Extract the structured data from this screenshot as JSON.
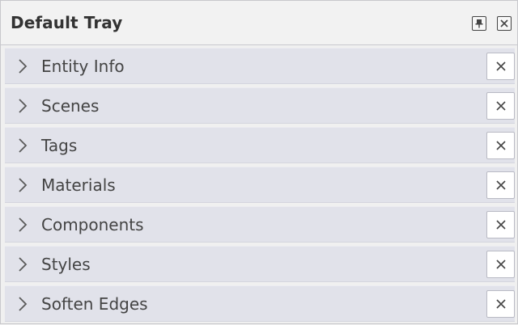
{
  "tray": {
    "title": "Default Tray",
    "header_icons": {
      "pin": "pin-icon",
      "close": "close-icon"
    }
  },
  "panels": [
    {
      "label": "Entity Info",
      "icon": "chevron-right-icon",
      "close_icon": "close-icon"
    },
    {
      "label": "Scenes",
      "icon": "chevron-right-icon",
      "close_icon": "close-icon"
    },
    {
      "label": "Tags",
      "icon": "chevron-right-icon",
      "close_icon": "close-icon"
    },
    {
      "label": "Materials",
      "icon": "chevron-right-icon",
      "close_icon": "close-icon"
    },
    {
      "label": "Components",
      "icon": "chevron-right-icon",
      "close_icon": "close-icon"
    },
    {
      "label": "Styles",
      "icon": "chevron-right-icon",
      "close_icon": "close-icon"
    },
    {
      "label": "Soften Edges",
      "icon": "chevron-right-icon",
      "close_icon": "close-icon"
    }
  ],
  "colors": {
    "panel_bg": "#e1e2ea",
    "text": "#444444",
    "title": "#333333"
  }
}
